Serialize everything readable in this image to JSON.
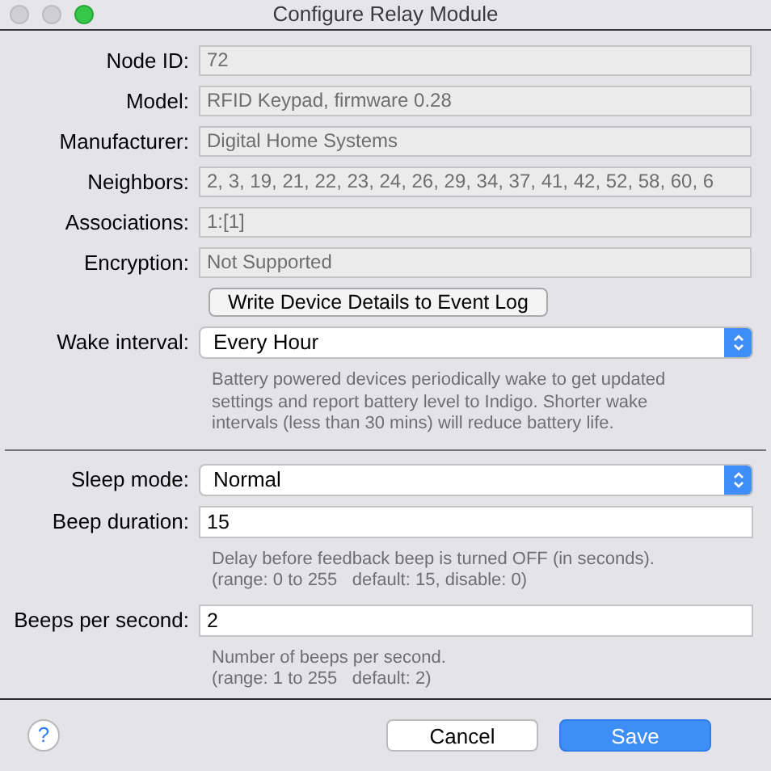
{
  "window": {
    "title": "Configure Relay Module"
  },
  "rows": [
    {
      "kind": "readonly",
      "label": "Node ID:",
      "value": "72"
    },
    {
      "kind": "readonly",
      "label": "Model:",
      "value": "RFID Keypad, firmware 0.28"
    },
    {
      "kind": "readonly",
      "label": "Manufacturer:",
      "value": "Digital Home Systems"
    },
    {
      "kind": "readonly",
      "label": "Neighbors:",
      "value": "2, 3, 19, 21, 22, 23, 24, 26, 29, 34, 37, 41, 42, 52, 58, 60, 6"
    },
    {
      "kind": "readonly",
      "label": "Associations:",
      "value": "1:[1]"
    },
    {
      "kind": "readonly",
      "label": "Encryption:",
      "value": "Not Supported"
    },
    {
      "kind": "button",
      "text": "Write Device Details to Event Log"
    },
    {
      "kind": "popup",
      "label": "Wake interval:",
      "value": "Every Hour"
    },
    {
      "kind": "help",
      "text": "Battery powered devices periodically wake to get updated\nsettings and report battery level to Indigo. Shorter wake\nintervals (less than 30 mins) will reduce battery life."
    },
    {
      "kind": "divider"
    },
    {
      "kind": "popup",
      "label": "Sleep mode:",
      "value": "Normal"
    },
    {
      "kind": "text",
      "label": "Beep duration:",
      "value": "15"
    },
    {
      "kind": "help",
      "text": "Delay before feedback beep is turned OFF (in seconds).\n(range: 0 to 255   default: 15, disable: 0)"
    },
    {
      "kind": "text",
      "label": "Beeps per second:",
      "value": "2"
    },
    {
      "kind": "help",
      "text": "Number of beeps per second.\n(range: 1 to 255   default: 2)"
    }
  ],
  "footer": {
    "help": "?",
    "buttons": [
      {
        "label": "Cancel",
        "default": false
      },
      {
        "label": "Save",
        "default": true
      }
    ]
  }
}
